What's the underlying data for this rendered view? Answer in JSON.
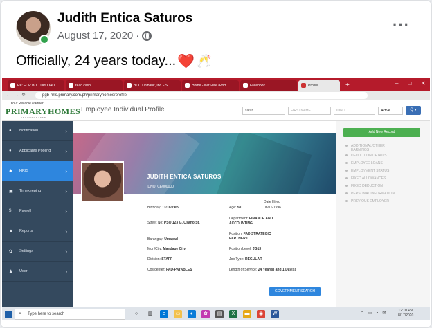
{
  "post": {
    "author": "Judith Entica Saturos",
    "date": "August 17, 2020",
    "separator": "·",
    "more": "···",
    "caption": "Officially, 24 years today...",
    "heart": "❤️",
    "glasses": "🥂"
  },
  "browser": {
    "tabs": [
      {
        "label": "Re: FOR BDO UPLOAD"
      },
      {
        "label": "read.cash"
      },
      {
        "label": "BDO Unibank, Inc. - S..."
      },
      {
        "label": "Home - NetSuite (Prim..."
      },
      {
        "label": "Facebook"
      },
      {
        "label": "Profile",
        "active": true
      }
    ],
    "new_tab": "+",
    "url": "pgb-hris.primary.com.ph/primaryhomes/profile",
    "nav": "←→↻"
  },
  "app": {
    "logo_tagline": "Your Reliable Partner",
    "logo": "PRIMARYHOMES",
    "logo_sub": "INCORPORATED",
    "page_title": "Employee Individual Profile",
    "search_value": "satur",
    "firstname_placeholder": "FIRSTNAME...",
    "idno_placeholder": "IDNO...",
    "status_select": "Active",
    "search_button": "Q ▾"
  },
  "sidebar": {
    "items": [
      {
        "icon": "●",
        "label": "Notification"
      },
      {
        "icon": "●",
        "label": "Applicants Pooling"
      },
      {
        "icon": "✱",
        "label": "HRIS"
      },
      {
        "icon": "▣",
        "label": "Timekeeping"
      },
      {
        "icon": "$",
        "label": "Payroll"
      },
      {
        "icon": "▲",
        "label": "Reports"
      },
      {
        "icon": "✿",
        "label": "Settings"
      },
      {
        "icon": "♟",
        "label": "User"
      }
    ],
    "active_index": 2,
    "chevron": "›"
  },
  "profile": {
    "name": "JUDITH ENTICA SATUROS",
    "idno": "IDNO. CE000000",
    "birthday_label": "Birthday:",
    "birthday": "11/16/1969",
    "age_label": "Age:",
    "age": "50",
    "date_hired_label": "Date Hired",
    "date_hired": "08/16/1996",
    "street_label": "Street No:",
    "street": "PSO 123 G. Osano St.",
    "department_label": "Department:",
    "department": "FINANCE AND ACCOUNTING",
    "barangay_label": "Barangay:",
    "barangay": "Umapad",
    "position_label": "Position:",
    "position": "FAD STRATEGIC PARTNER I",
    "muncity_label": "Mun/City:",
    "muncity": "Mandaue City",
    "position_level_label": "Position Level:",
    "position_level": "JG13",
    "division_label": "Division:",
    "division": "STAFF",
    "job_type_label": "Job Type:",
    "job_type": "REGULAR",
    "costcenter_label": "Costcenter:",
    "costcenter": "FAD-PAYABLES",
    "length_label": "Length of Service:",
    "length": "24 Year(s) and 1 Day(s)",
    "gov_button": "GOVERNMENT SEARCH"
  },
  "right_panel": {
    "add_button": "Add New Record",
    "items": [
      "ADDITIONAL/OTHER EARNINGS",
      "DEDUCTION DETAILS",
      "EMPLOYEE LOANS",
      "EMPLOYMENT STATUS",
      "FIXED ALLOWANCES",
      "FIXED DEDUCTION",
      "PERSONAL INFORMATION",
      "PREVIOUS EMPLOYER"
    ]
  },
  "taskbar": {
    "search_placeholder": "Type here to search",
    "time": "12:10 PM",
    "date": "8/17/2020"
  }
}
